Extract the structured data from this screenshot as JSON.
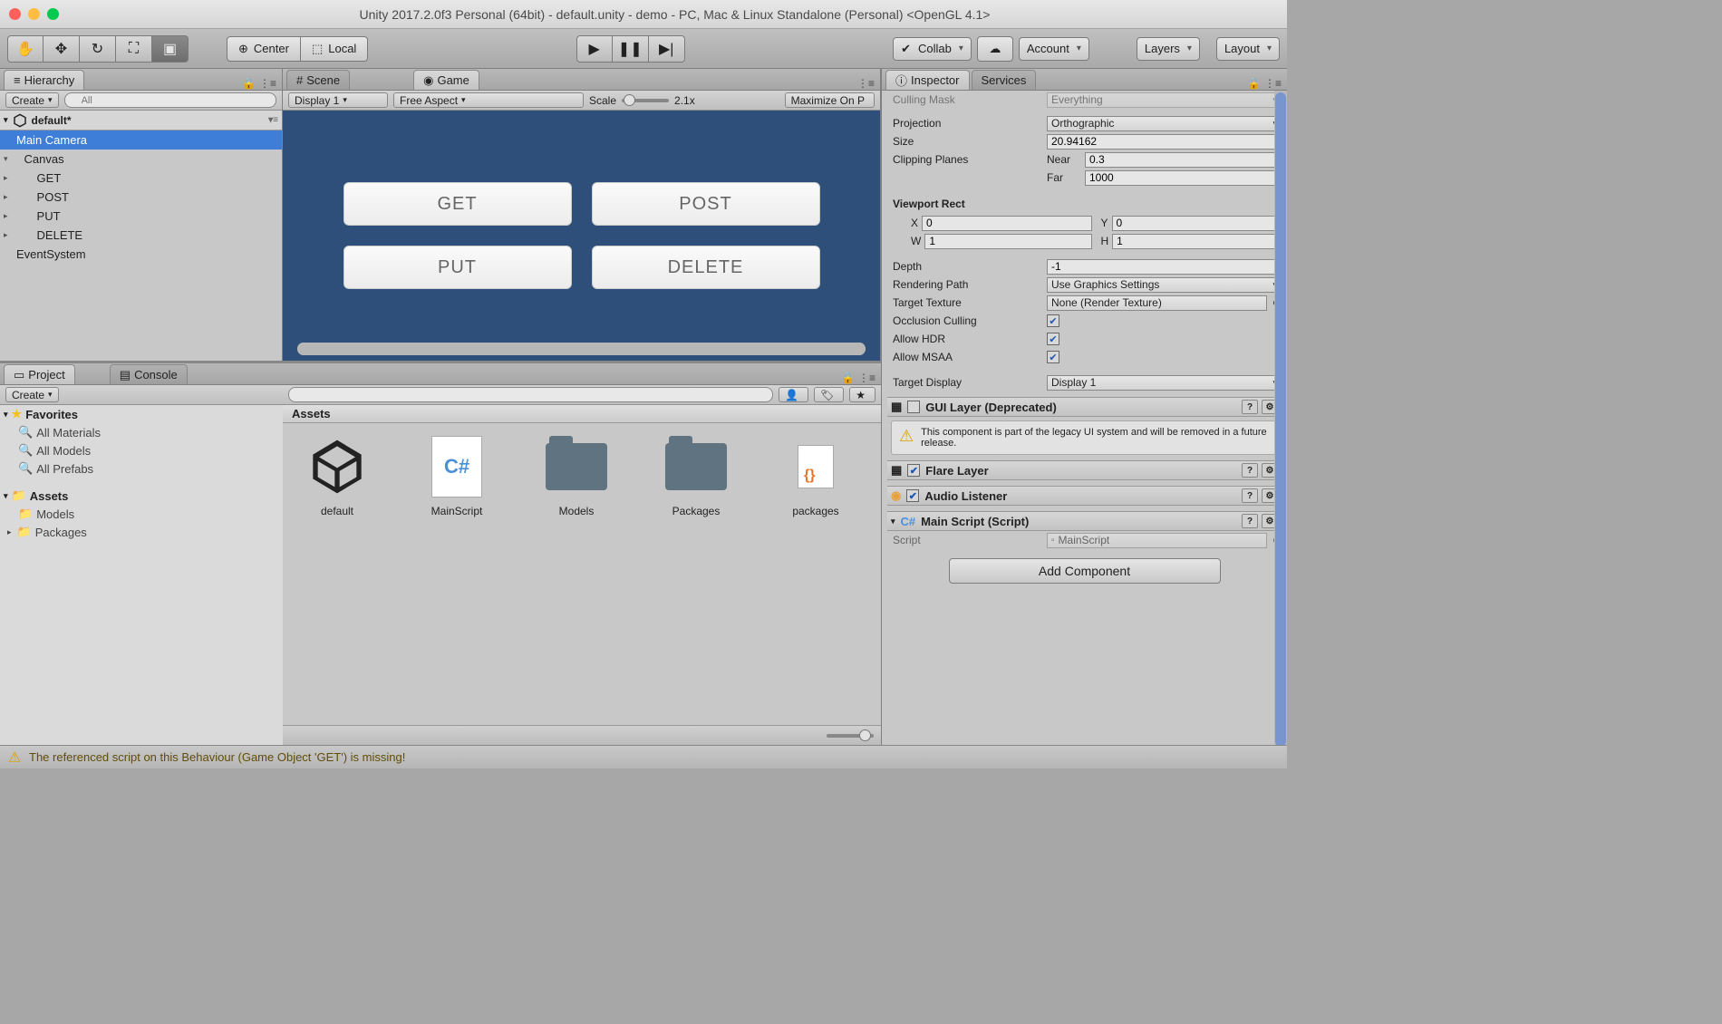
{
  "window": {
    "title": "Unity 2017.2.0f3 Personal (64bit) - default.unity - demo - PC, Mac & Linux Standalone (Personal) <OpenGL 4.1>"
  },
  "toolbar": {
    "pivot": "Center",
    "local": "Local",
    "collab": "Collab",
    "account": "Account",
    "layers": "Layers",
    "layout": "Layout"
  },
  "hierarchy": {
    "tab": "Hierarchy",
    "create": "Create",
    "search_placeholder": "All",
    "scene": "default*",
    "items": [
      "Main Camera",
      "Canvas",
      "GET",
      "POST",
      "PUT",
      "DELETE",
      "EventSystem"
    ]
  },
  "sceneTab": "Scene",
  "gameTab": "Game",
  "gameBar": {
    "display": "Display 1",
    "aspect": "Free Aspect",
    "scaleLabel": "Scale",
    "scaleVal": "2.1x",
    "maximize": "Maximize On P"
  },
  "gameButtons": [
    "GET",
    "POST",
    "PUT",
    "DELETE"
  ],
  "project": {
    "tab": "Project",
    "consoleTab": "Console",
    "create": "Create",
    "favorites": "Favorites",
    "favItems": [
      "All Materials",
      "All Models",
      "All Prefabs"
    ],
    "assetsHeader": "Assets",
    "assetsFolder": "Assets",
    "treeItems": [
      "Models",
      "Packages"
    ],
    "gridItems": [
      "default",
      "MainScript",
      "Models",
      "Packages",
      "packages"
    ]
  },
  "inspector": {
    "tab": "Inspector",
    "servicesTab": "Services",
    "cullingMask": "Culling Mask",
    "cullingVal": "Everything",
    "projection": "Projection",
    "projectionVal": "Orthographic",
    "size": "Size",
    "sizeVal": "20.94162",
    "clipping": "Clipping Planes",
    "near": "Near",
    "nearVal": "0.3",
    "far": "Far",
    "farVal": "1000",
    "viewport": "Viewport Rect",
    "x": "X",
    "xVal": "0",
    "y": "Y",
    "yVal": "0",
    "w": "W",
    "wVal": "1",
    "h": "H",
    "hVal": "1",
    "depth": "Depth",
    "depthVal": "-1",
    "renderPath": "Rendering Path",
    "renderPathVal": "Use Graphics Settings",
    "targetTex": "Target Texture",
    "targetTexVal": "None (Render Texture)",
    "occlusion": "Occlusion Culling",
    "allowHDR": "Allow HDR",
    "allowMSAA": "Allow MSAA",
    "targetDisplay": "Target Display",
    "targetDisplayVal": "Display 1",
    "guiLayer": "GUI Layer (Deprecated)",
    "guiWarning": "This component is part of the legacy UI system and will be removed in a future release.",
    "flareLayer": "Flare Layer",
    "audioListener": "Audio Listener",
    "mainScript": "Main Script (Script)",
    "scriptLabel": "Script",
    "scriptVal": "MainScript",
    "addComponent": "Add Component"
  },
  "status": {
    "msg": "The referenced script on this Behaviour (Game Object 'GET') is missing!"
  }
}
